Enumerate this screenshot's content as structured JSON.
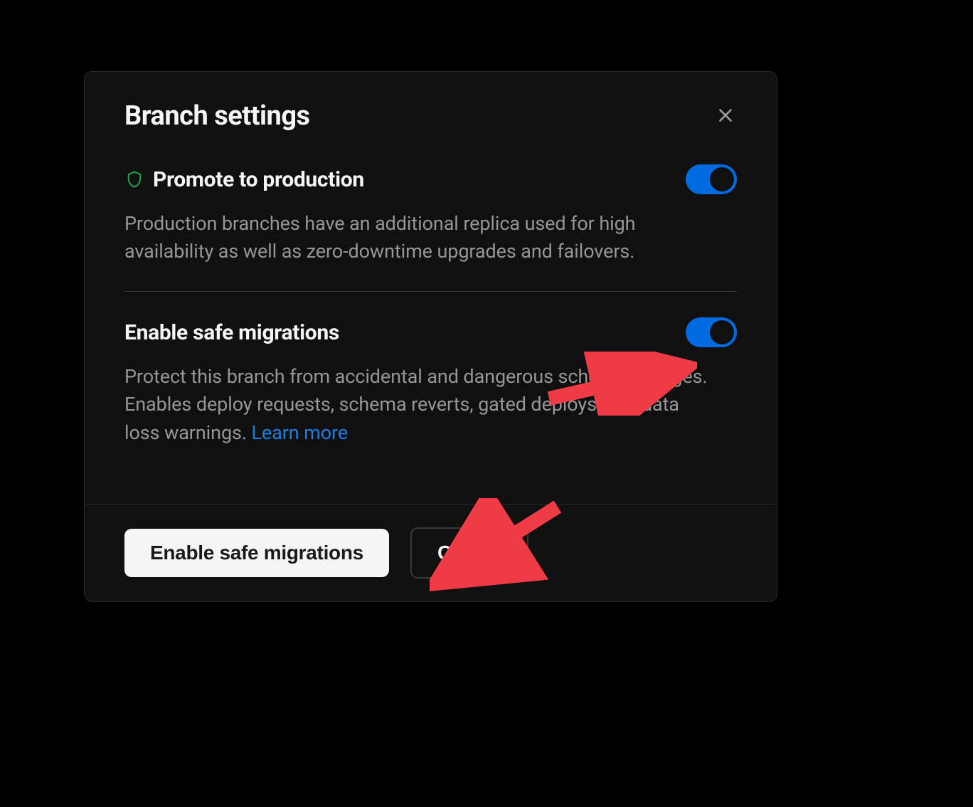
{
  "modal": {
    "title": "Branch settings",
    "settings": {
      "promote": {
        "title": "Promote to production",
        "description": "Production branches have an additional replica used for high availability as well as zero-downtime upgrades and failovers.",
        "toggled": true
      },
      "safe_migrations": {
        "title": "Enable safe migrations",
        "description_pre": "Protect this branch from accidental and dangerous schema changes. Enables deploy requests, schema reverts, gated deploys, and data loss warnings. ",
        "learn_more": "Learn more",
        "toggled": true
      }
    },
    "footer": {
      "primary": "Enable safe migrations",
      "cancel": "Cancel"
    }
  }
}
